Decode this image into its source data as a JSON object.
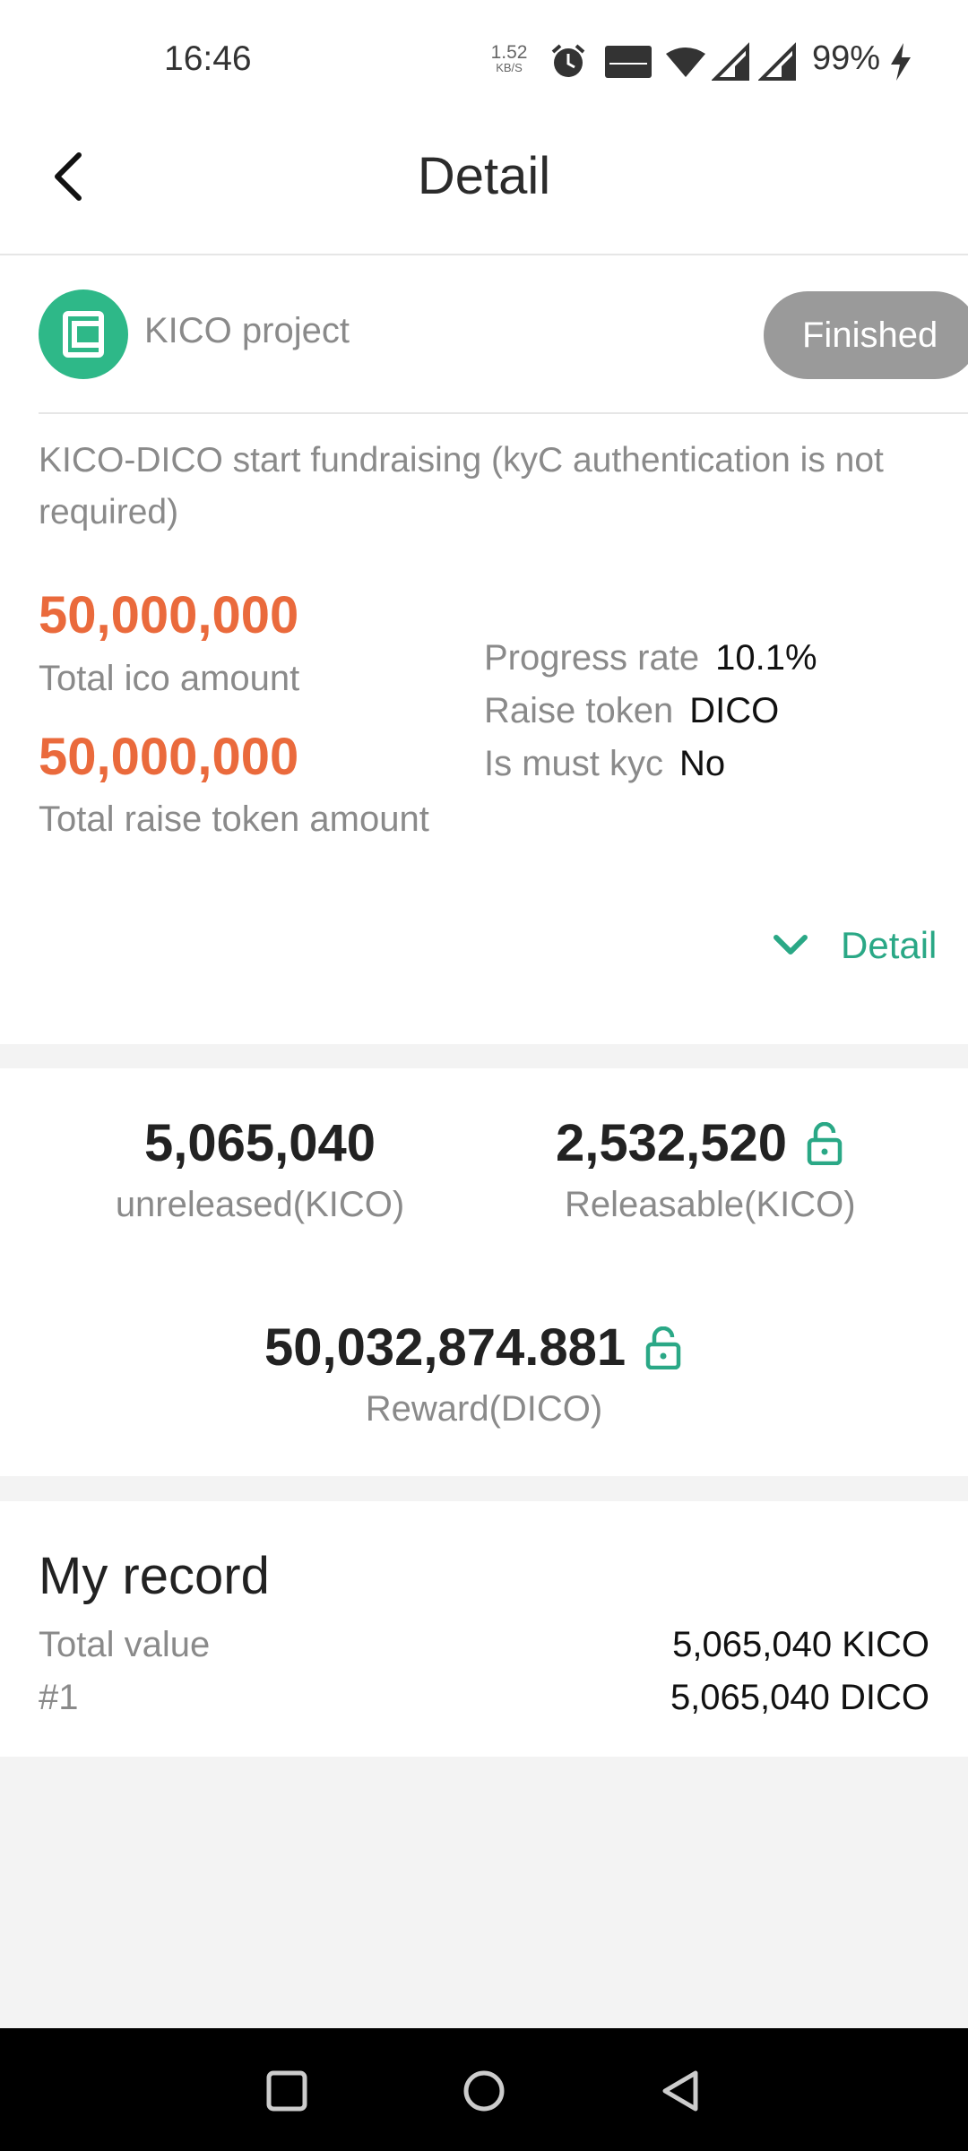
{
  "status_bar": {
    "time": "16:46",
    "net_speed_value": "1.52",
    "net_speed_unit": "KB/S",
    "battery": "99%",
    "icons": [
      "alarm-icon",
      "volte-icon",
      "wifi-icon",
      "signal-4g-icon",
      "signal-4g-icon",
      "charging-icon"
    ]
  },
  "header": {
    "title": "Detail",
    "back_icon": "chevron-left-icon"
  },
  "project": {
    "name": "KICO project",
    "status": "Finished",
    "description": "KICO-DICO start fundraising (kyC authentication is not required)",
    "total_ico_amount": "50,000,000",
    "total_ico_label": "Total ico amount",
    "total_raise_amount": "50,000,000",
    "total_raise_label": "Total raise token amount",
    "progress_label": "Progress rate",
    "progress_value": "10.1%",
    "raise_token_label": "Raise token",
    "raise_token_value": "DICO",
    "kyc_label": "Is must kyc",
    "kyc_value": "No",
    "detail_toggle_label": "Detail",
    "accent_color": "#2aa886",
    "amount_color": "#ea6a3c"
  },
  "release": {
    "unreleased_value": "5,065,040",
    "unreleased_label": "unreleased(KICO)",
    "releasable_value": "2,532,520",
    "releasable_label": "Releasable(KICO)",
    "reward_value": "50,032,874.881",
    "reward_label": "Reward(DICO)"
  },
  "record": {
    "title": "My record",
    "total_label": "Total value",
    "total_value": "5,065,040 KICO",
    "row1_label": "#1",
    "row1_value": "5,065,040 DICO"
  }
}
